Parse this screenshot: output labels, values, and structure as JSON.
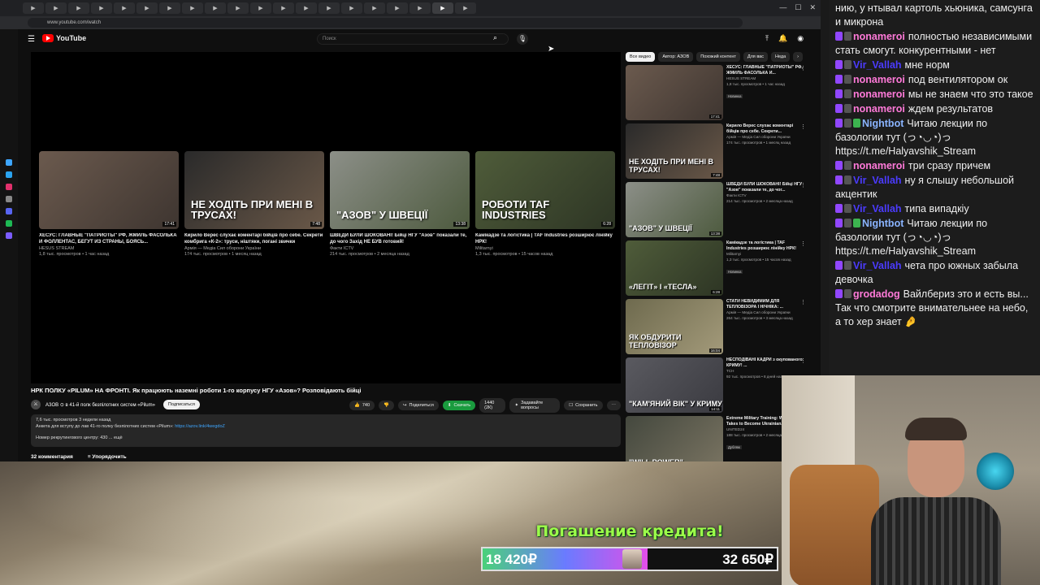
{
  "browser": {
    "url": "www.youtube.com/watch",
    "tabs": [
      "▶",
      "▶",
      "▶",
      "▶",
      "▶",
      "▶",
      "▶",
      "▶",
      "▶",
      "▶",
      "▶",
      "▶",
      "▶",
      "▶",
      "▶",
      "▶",
      "▶",
      "▶",
      "▶",
      "▶"
    ]
  },
  "yt": {
    "logo": "YouTube",
    "search_placeholder": "Поиск",
    "endcards": [
      {
        "title": "ХЕСУС: ГЛАВНЫЕ \"ПАТРИОТЫ\" РФ, ЖМИЛЬ ФАСОЛЬКА И ФОЛЛЕНТАС, БЕГУТ ИЗ СТРАНЫ, БОЯСЬ...",
        "channel": "HESUS STREAM",
        "meta": "1,8 тыс. просмотров • 1 час назад",
        "duration": "17:41",
        "overlay": "",
        "color": "linear-gradient(135deg,#6b5a4e,#3e3530)"
      },
      {
        "title": "Кирило Верес слухає коментарі бійців про себе. Секрети комбрига «К-2»: труси, ніштяки, погані звички",
        "channel": "Армія — Медіа Сил оборони України",
        "meta": "174 тыс. просмотров • 1 месяц назад",
        "duration": "7:48",
        "overlay": "НЕ ХОДІТЬ ПРИ МЕНІ В ТРУСАХ!",
        "color": "linear-gradient(135deg,#2a2a2a,#6a5848)"
      },
      {
        "title": "ШВЕДИ БУЛИ ШОКОВАНІ! Бійці НГУ \"Азов\" показали те, до чого Захід НЕ БУВ готовий!",
        "channel": "Факти ICTV",
        "meta": "214 тыс. просмотров • 2 месяца назад",
        "duration": "13:38",
        "overlay": "\"АЗОВ\" У ШВЕЦІЇ",
        "color": "linear-gradient(135deg,#8c8f88,#4d5a3e)"
      },
      {
        "title": "Камікадзе та логістика | TAF Industries розширює лінійку НРК!",
        "channel": "Militarnyi",
        "meta": "1,3 тыс. просмотров • 15 часов назад",
        "duration": "6:28",
        "overlay": "РОБОТИ TAF INDUSTRIES",
        "color": "linear-gradient(135deg,#4f5c3a,#2d3524)"
      }
    ],
    "video_title": "НРК ПОЛКУ «PILUM» НА ФРОНТІ. Як працюють наземні роботи 1-го корпусу НГУ «Азов»? Розповідають бійці",
    "channel": "АЗОВ ⊙ в 41-й полк безпілотних систем «Pilum»",
    "subscribe": "Подписаться",
    "likes": "740",
    "share": "Поделиться",
    "download": "Скачать",
    "download_quality": "1440 (2К)",
    "ask": "Задавайте вопросы",
    "save": "Сохранить",
    "desc_line1": "7,6 тыс. просмотров  3 недели назад",
    "desc_line2": "Анкета для вступу до лав 41-го полку безпілотних систем «Pilum»: ",
    "desc_link": "https://azov.link/4wegdoZ",
    "desc_line3": "Номер рекрутингового центру: 430 ... ещё",
    "comments": "32 комментария",
    "sort": "Упорядочить",
    "chips": [
      "Все видео",
      "Автор: АЗОВ",
      "Похожий контент",
      "Для вас",
      "Неда"
    ],
    "related": [
      {
        "title": "ХЕСУС: ГЛАВНЫЕ \"ПАТРИОТЫ\" РФ, ЖМИЛЬ ФАСОЛЬКА И...",
        "channel": "HESUS STREAM",
        "meta": "1,8 тыс. просмотров • 1 час назад",
        "badge": "Новинка",
        "duration": "17:41",
        "overlay": "",
        "color": "linear-gradient(135deg,#6b5a4e,#3e3530)"
      },
      {
        "title": "Кирило Верес слухає коментарі бійців про себе. Секрети...",
        "channel": "Армія — Медіа Сил оборони України",
        "meta": "174 тыс. просмотров • 1 месяц назад",
        "badge": "",
        "duration": "7:48",
        "overlay": "НЕ ХОДІТЬ ПРИ МЕНІ В ТРУСАХ!",
        "color": "linear-gradient(135deg,#2a2a2a,#6a5848)"
      },
      {
        "title": "ШВЕДИ БУЛИ ШОКОВАНІ! Бійці НГУ \"Азов\" показали те, до чог...",
        "channel": "Факти ICTV",
        "meta": "214 тыс. просмотров • 2 месяца назад",
        "badge": "",
        "duration": "13:38",
        "overlay": "\"АЗОВ\" У ШВЕЦІЇ",
        "color": "linear-gradient(135deg,#8c8f88,#4d5a3e)"
      },
      {
        "title": "Камікадзе та логістика | TAF Industries розширює лінійку НРК!",
        "channel": "Militarnyi",
        "meta": "1,3 тыс. просмотров • 15 часов назад",
        "badge": "Новинка",
        "duration": "6:28",
        "overlay": "«ЛЕГІТ» І «ТЕСЛА»",
        "color": "linear-gradient(135deg,#4f5c3a,#2d3524)"
      },
      {
        "title": "СТАТИ НЕВИДИМИМ ДЛЯ ТЕПЛОВІЗОРА І НІЧНІКА: ...",
        "channel": "Армія — Медіа Сил оборони України",
        "meta": "264 тыс. просмотров • 3 месяца назад",
        "badge": "",
        "duration": "16:04",
        "overlay": "ЯК ОБДУРИТИ ТЕПЛОВІЗОР",
        "color": "linear-gradient(135deg,#6e6a4e,#a39a7a)"
      },
      {
        "title": "НЕСПОДІВАНІ КАДРИ з окупованого КРИМУ! ...",
        "channel": "ТСН",
        "meta": "92 тыс. просмотров • 8 дней назад",
        "badge": "",
        "duration": "14:11",
        "overlay": "\"КАМ'ЯНИЙ ВІК\" У КРИМУ",
        "color": "linear-gradient(135deg,#5a5a60,#3a3a40)"
      },
      {
        "title": "Extreme Military Training: What It Takes to Become Ukrainian...",
        "channel": "UNITED24",
        "meta": "188 тыс. просмотров • 2 месяца назад",
        "badge": "Дубляж",
        "duration": "",
        "overlay": "\"WILL POWER\"",
        "color": "linear-gradient(135deg,#44483e,#7a7462)"
      }
    ]
  },
  "chat": [
    {
      "user": "",
      "color": "#efefef",
      "text": "нию, у нтывал картоль хьюника, самсунга и микрона",
      "badges": 0
    },
    {
      "user": "nonameroi",
      "color": "#ff7ad9",
      "text": "полностью независимыми стать смогут. конкурентными - нет",
      "badges": 2
    },
    {
      "user": "Vir_Vallah",
      "color": "#4b3bff",
      "text": "мне норм",
      "badges": 2
    },
    {
      "user": "nonameroi",
      "color": "#ff7ad9",
      "text": "под вентилятором ок",
      "badges": 2
    },
    {
      "user": "nonameroi",
      "color": "#ff7ad9",
      "text": "мы не знаем что это такое",
      "badges": 2
    },
    {
      "user": "nonameroi",
      "color": "#ff7ad9",
      "text": "ждем результатов",
      "badges": 2
    },
    {
      "user": "Nightbot",
      "color": "#8ab4ff",
      "text": "Читаю лекции по базологии тут (っ◔◡◔)っ https://t.me/Halyavshik_Stream",
      "badges": 3
    },
    {
      "user": "nonameroi",
      "color": "#ff7ad9",
      "text": "три сразу причем",
      "badges": 2
    },
    {
      "user": "Vir_Vallah",
      "color": "#4b3bff",
      "text": "ну я слышу небольшой акцентик",
      "badges": 2
    },
    {
      "user": "Vir_Vallah",
      "color": "#4b3bff",
      "text": "типа випадкіу",
      "badges": 2
    },
    {
      "user": "Nightbot",
      "color": "#8ab4ff",
      "text": "Читаю лекции по базологии тут (っ◔◡◔)っ https://t.me/Halyavshik_Stream",
      "badges": 3
    },
    {
      "user": "Vir_Vallah",
      "color": "#4b3bff",
      "text": "чета про южных забыла девочка",
      "badges": 2
    },
    {
      "user": "grodadog",
      "color": "#ff7ad9",
      "text": "Вайлбериз это и есть вы... Так что смотрите внимательнее на небо, а то хер знает 🤌",
      "badges": 2
    }
  ],
  "donate": {
    "title": "Погашение кредита!",
    "current": "18 420₽",
    "goal": "32 650₽",
    "progress": 0.56
  }
}
